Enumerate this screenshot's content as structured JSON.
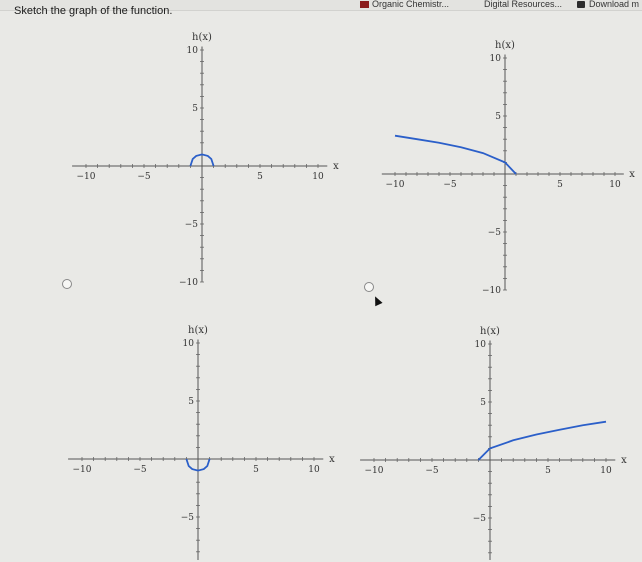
{
  "browser": {
    "bookmarks": [
      {
        "label": "Organic Chemistr..."
      },
      {
        "label": "Digital Resources..."
      },
      {
        "label": "Download m"
      }
    ]
  },
  "question": {
    "text": "Sketch the graph of the function."
  },
  "options": [
    {
      "id": "A",
      "chart_data": {
        "type": "line",
        "xlabel": "x",
        "ylabel": "h(x)",
        "xlim": [
          -10,
          10
        ],
        "ylim": [
          -10,
          10
        ],
        "x_ticks": [
          "-10",
          "-5",
          "5",
          "10"
        ],
        "y_ticks": [
          "10",
          "5",
          "-5",
          "-10"
        ],
        "series": [
          {
            "color": "#2b5fc9",
            "x": [
              -1,
              -0.8,
              -0.5,
              0,
              0.5,
              0.8,
              1
            ],
            "y": [
              0,
              0.6,
              0.87,
              1,
              0.87,
              0.6,
              0
            ]
          }
        ]
      }
    },
    {
      "id": "B",
      "chart_data": {
        "type": "line",
        "xlabel": "x",
        "ylabel": "h(x)",
        "xlim": [
          -10,
          10
        ],
        "ylim": [
          -10,
          10
        ],
        "x_ticks": [
          "-10",
          "-5",
          "5",
          "10"
        ],
        "y_ticks": [
          "10",
          "5",
          "-5",
          "-10"
        ],
        "series": [
          {
            "color": "#2b5fc9",
            "x": [
              -10,
              -8,
              -6,
              -4,
              -2,
              0,
              1
            ],
            "y": [
              3.3,
              3.0,
              2.7,
              2.3,
              1.8,
              1.0,
              0
            ]
          }
        ]
      }
    },
    {
      "id": "C",
      "chart_data": {
        "type": "line",
        "xlabel": "x",
        "ylabel": "h(x)",
        "xlim": [
          -10,
          10
        ],
        "ylim": [
          -10,
          10
        ],
        "x_ticks": [
          "-10",
          "-5",
          "5",
          "10"
        ],
        "y_ticks": [
          "10",
          "5",
          "-5"
        ],
        "series": [
          {
            "color": "#2b5fc9",
            "x": [
              -1,
              -0.8,
              -0.5,
              0,
              0.5,
              0.8,
              1
            ],
            "y": [
              0,
              -0.6,
              -0.87,
              -1,
              -0.87,
              -0.6,
              0
            ]
          }
        ]
      }
    },
    {
      "id": "D",
      "chart_data": {
        "type": "line",
        "xlabel": "x",
        "ylabel": "h(x)",
        "xlim": [
          -10,
          10
        ],
        "ylim": [
          -10,
          10
        ],
        "x_ticks": [
          "-10",
          "-5",
          "5",
          "10"
        ],
        "y_ticks": [
          "10",
          "5",
          "-5"
        ],
        "series": [
          {
            "color": "#2b5fc9",
            "x": [
              -1,
              0,
              2,
              4,
              6,
              8,
              10
            ],
            "y": [
              0,
              1.0,
              1.7,
              2.2,
              2.6,
              3.0,
              3.3
            ]
          }
        ]
      }
    }
  ]
}
